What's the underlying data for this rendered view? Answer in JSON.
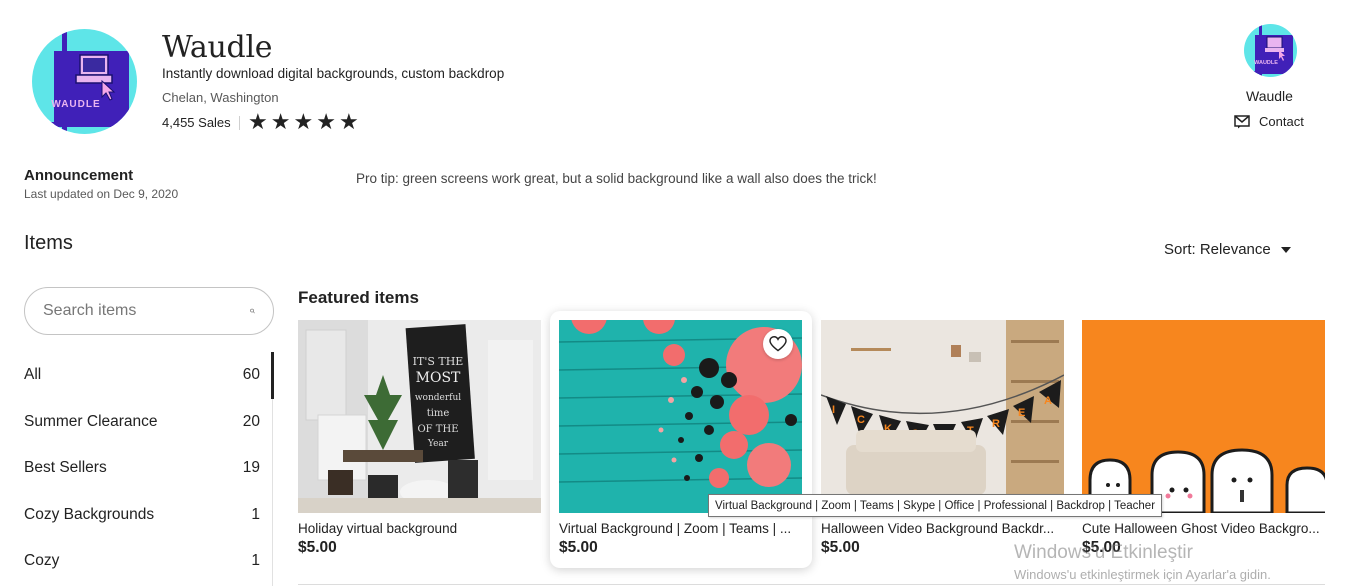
{
  "shop": {
    "name": "Waudle",
    "tagline": "Instantly download digital backgrounds, custom backdrop",
    "location": "Chelan, Washington",
    "sales": "4,455 Sales",
    "rating_stars": 5,
    "logo_text": "WAUDLE"
  },
  "owner": {
    "name": "Waudle",
    "contact_label": "Contact"
  },
  "announcement": {
    "title": "Announcement",
    "updated": "Last updated on Dec 9, 2020",
    "text": "Pro tip: green screens work great, but a solid background like a wall also does the trick!"
  },
  "items": {
    "title": "Items",
    "sort_label": "Sort: Relevance"
  },
  "search": {
    "placeholder": "Search items"
  },
  "categories": [
    {
      "label": "All",
      "count": "60"
    },
    {
      "label": "Summer Clearance",
      "count": "20"
    },
    {
      "label": "Best Sellers",
      "count": "19"
    },
    {
      "label": "Cozy Backgrounds",
      "count": "1"
    },
    {
      "label": "Cozy",
      "count": "1"
    }
  ],
  "featured": {
    "title": "Featured items",
    "cards": [
      {
        "title": "Holiday virtual background",
        "price": "$5.00",
        "image": "chalkboard-christmas-room"
      },
      {
        "title": "Virtual Background | Zoom | Teams | ...",
        "price": "$5.00",
        "image": "teal-wood-pumpkins"
      },
      {
        "title": "Halloween Video Background Backdr...",
        "price": "$5.00",
        "image": "trick-or-treat-banner-room"
      },
      {
        "title": "Cute Halloween Ghost Video Backgro...",
        "price": "$5.00",
        "image": "orange-ghosts"
      }
    ]
  },
  "tooltip": "Virtual Background | Zoom | Teams | Skype | Office | Professional | Backdrop | Teacher",
  "watermark": {
    "line1": "Windows'u Etkinleştir",
    "line2": "Windows'u etkinleştirmek için Ayarlar'a gidin."
  },
  "colors": {
    "logo_bg": "#5ee5e8",
    "logo_square": "#4020b8",
    "accent_orange": "#f7861e",
    "teal": "#1fb3ac"
  }
}
